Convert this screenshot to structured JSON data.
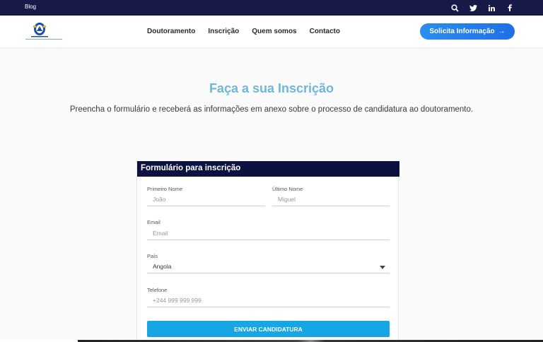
{
  "topbar": {
    "blog_label": "Blog",
    "icons": [
      "search-icon",
      "twitter-icon",
      "linkedin-icon",
      "facebook-icon"
    ]
  },
  "nav": {
    "items": [
      "Doutoramento",
      "Inscrição",
      "Quem somos",
      "Contacto"
    ],
    "cta_label": "Solicita Informação",
    "cta_arrow": "→"
  },
  "hero": {
    "title": "Faça a sua Inscrição",
    "subtitle": "Preencha o formulário e receberá as informações em anexo sobre o processo de candidatura ao doutoramento."
  },
  "form": {
    "header": "Formulário para inscrição",
    "first_name": {
      "label": "Primeiro Nome",
      "placeholder": "João"
    },
    "last_name": {
      "label": "Último Nome",
      "placeholder": "Miguel"
    },
    "email": {
      "label": "Email",
      "placeholder": "Email"
    },
    "country": {
      "label": "País",
      "value": "Angola"
    },
    "phone": {
      "label": "Telefone",
      "placeholder": "+244 999 999 999"
    },
    "submit_label": "ENVIAR CANDIDATURA"
  },
  "colors": {
    "topbar": "#171a47",
    "form_header": "#0d1140",
    "accent": "#6fb6dd",
    "cta": "#1f6fe6",
    "submit": "#16a6e3"
  }
}
